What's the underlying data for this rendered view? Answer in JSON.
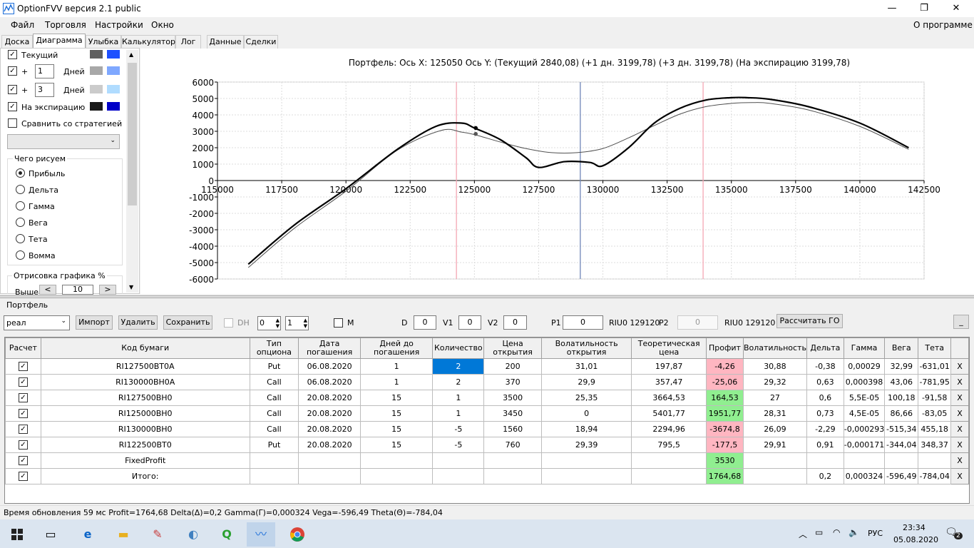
{
  "window": {
    "title": "OptionFVV версия 2.1 public",
    "min": "—",
    "max": "❐",
    "close": "✕"
  },
  "menu": {
    "file": "Файл",
    "trade": "Торговля",
    "settings": "Настройки",
    "window": "Окно",
    "about": "О программе"
  },
  "tabs": [
    "Доска",
    "Диаграмма",
    "Улыбка",
    "Калькулятор",
    "Лог",
    "Данные",
    "Сделки"
  ],
  "left": {
    "current": "Текущий",
    "plus": "+",
    "days1": "1",
    "days2": "3",
    "days_label": "Дней",
    "expiry": "На экспирацию",
    "compare": "Сравнить со стратегией",
    "draw_group": "Чего рисуем",
    "radios": [
      "Прибыль",
      "Дельта",
      "Гамма",
      "Вега",
      "Тета",
      "Вомма"
    ],
    "render_group": "Отрисовка графика %",
    "above": "Выше",
    "lt": "<",
    "gt": ">",
    "pct": "10",
    "swatches": {
      "current": [
        "#606060",
        "#1e50ff"
      ],
      "d1": [
        "#a8a8a8",
        "#7fa8ff"
      ],
      "d3": [
        "#cbcbcb",
        "#b0dcff"
      ],
      "expiry": [
        "#1a1a1a",
        "#0000c8"
      ]
    }
  },
  "chart_data": {
    "type": "line",
    "title": "Портфель: Ось X: 125050 Ось Y:  (Текущий 2840,08)  (+1 дн. 3199,78)  (+3 дн. 3199,78)  (На экспирацию 3199,78)",
    "xlim": [
      115000,
      142500
    ],
    "ylim": [
      -6000,
      6000
    ],
    "xticks": [
      115000,
      117500,
      120000,
      122500,
      125000,
      127500,
      130000,
      132500,
      135000,
      137500,
      140000,
      142500
    ],
    "yticks": [
      -6000,
      -5000,
      -4000,
      -3000,
      -2000,
      -1000,
      0,
      1000,
      2000,
      3000,
      4000,
      5000,
      6000
    ],
    "grid": true,
    "vlines": [
      {
        "x": 124300,
        "color": "#f4a6b4"
      },
      {
        "x": 129120,
        "color": "#6f86b8"
      },
      {
        "x": 133900,
        "color": "#f4a6b4"
      }
    ],
    "series": [
      {
        "color": "#000000",
        "width": 2.2,
        "x": [
          116200,
          118000,
          120000,
          122000,
          123500,
          124500,
          125000,
          126000,
          127000,
          127500,
          128500,
          129500,
          130000,
          131000,
          132000,
          133000,
          134000,
          135000,
          135600,
          136500,
          138000,
          140000,
          141900
        ],
        "y": [
          -5100,
          -2700,
          -500,
          1900,
          3300,
          3500,
          3200,
          2500,
          1400,
          800,
          1150,
          1100,
          900,
          2000,
          3500,
          4400,
          4900,
          5050,
          5050,
          4950,
          4500,
          3500,
          2000
        ]
      },
      {
        "color": "#505050",
        "width": 1,
        "x": [
          116200,
          118000,
          120000,
          122000,
          123700,
          124500,
          125000,
          126000,
          127000,
          128000,
          129000,
          130000,
          131000,
          132000,
          133000,
          134000,
          135000,
          135800,
          136500,
          138000,
          140000,
          141900
        ],
        "y": [
          -5300,
          -2900,
          -650,
          1850,
          3050,
          2950,
          2800,
          2350,
          1950,
          1700,
          1700,
          1950,
          2600,
          3350,
          4050,
          4500,
          4700,
          4750,
          4700,
          4300,
          3300,
          1900
        ]
      }
    ],
    "markers": [
      {
        "x": 125050,
        "y": 3199.78,
        "color": "#000000"
      },
      {
        "x": 125050,
        "y": 2840.08,
        "color": "#555555"
      }
    ]
  },
  "portfolio": {
    "title": "Портфель",
    "account": "реал",
    "import": "Импорт",
    "delete": "Удалить",
    "save": "Сохранить",
    "dh": "DH",
    "spin1": "0",
    "spin2": "1",
    "m": "M",
    "d_label": "D",
    "d_val": "0",
    "v1_label": "V1",
    "v1_val": "0",
    "v2_label": "V2",
    "v2_val": "0",
    "p1_label": "P1",
    "p1_val": "0",
    "p1_code": "RIU0 129120",
    "p2_label": "P2",
    "p2_val": "0",
    "p2_code": "RIU0 129120",
    "calc": "Рассчитать ГО",
    "min": "_"
  },
  "table": {
    "headers": [
      "Расчет",
      "Код бумаги",
      "Тип опциона",
      "Дата погашения",
      "Дней до погашения",
      "Количество",
      "Цена открытия",
      "Волатильность открытия",
      "Теоретическая цена",
      "Профит",
      "Волатильность",
      "Дельта",
      "Гамма",
      "Вега",
      "Тета",
      ""
    ],
    "rows": [
      [
        "✓",
        "RI127500BT0A",
        "Put",
        "06.08.2020",
        "1",
        "2",
        "200",
        "31,01",
        "197,87",
        "-4,26",
        "30,88",
        "-0,38",
        "0,00029",
        "32,99",
        "-631,01",
        "X"
      ],
      [
        "✓",
        "RI130000BH0A",
        "Call",
        "06.08.2020",
        "1",
        "2",
        "370",
        "29,9",
        "357,47",
        "-25,06",
        "29,32",
        "0,63",
        "0,000398",
        "43,06",
        "-781,95",
        "X"
      ],
      [
        "✓",
        "RI127500BH0",
        "Call",
        "20.08.2020",
        "15",
        "1",
        "3500",
        "25,35",
        "3664,53",
        "164,53",
        "27",
        "0,6",
        "5,5E-05",
        "100,18",
        "-91,58",
        "X"
      ],
      [
        "✓",
        "RI125000BH0",
        "Call",
        "20.08.2020",
        "15",
        "1",
        "3450",
        "0",
        "5401,77",
        "1951,77",
        "28,31",
        "0,73",
        "4,5E-05",
        "86,66",
        "-83,05",
        "X"
      ],
      [
        "✓",
        "RI130000BH0",
        "Call",
        "20.08.2020",
        "15",
        "-5",
        "1560",
        "18,94",
        "2294,96",
        "-3674,8",
        "26,09",
        "-2,29",
        "-0,000293",
        "-515,34",
        "455,18",
        "X"
      ],
      [
        "✓",
        "RI122500BT0",
        "Put",
        "20.08.2020",
        "15",
        "-5",
        "760",
        "29,39",
        "795,5",
        "-177,5",
        "29,91",
        "0,91",
        "-0,000171",
        "-344,04",
        "348,37",
        "X"
      ],
      [
        "✓",
        "FixedProfit",
        "",
        "",
        "",
        "",
        "",
        "",
        "",
        "3530",
        "",
        "",
        "",
        "",
        "",
        "X"
      ],
      [
        "✓",
        "Итого:",
        "",
        "",
        "",
        "",
        "",
        "",
        "",
        "1764,68",
        "",
        "0,2",
        "0,000324",
        "-596,49",
        "-784,04",
        "X"
      ]
    ],
    "profit_colors": [
      "pink",
      "pink",
      "green",
      "green",
      "pink",
      "pink",
      "green",
      "green"
    ]
  },
  "status": "Время обновления 59 мс  Profit=1764,68 Delta(Δ)=0,2 Gamma(Γ)=0,000324 Vega=-596,49 Theta(Θ)=-784,04",
  "taskbar": {
    "lang": "РУС",
    "time": "23:34",
    "date": "05.08.2020",
    "notif": "2"
  }
}
